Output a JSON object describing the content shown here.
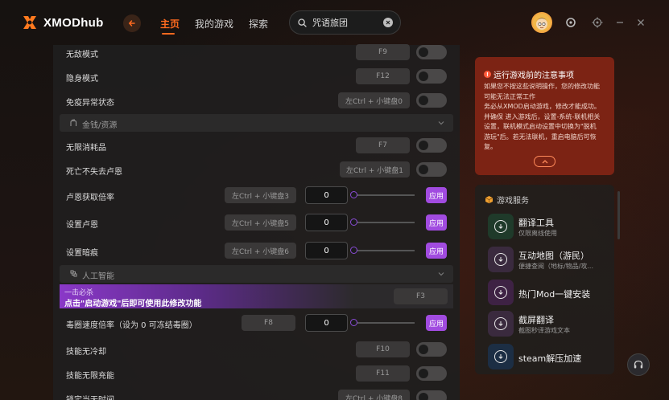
{
  "app": {
    "title": "XMODhub"
  },
  "nav": {
    "home": "主页",
    "my_games": "我的游戏",
    "explore": "探索"
  },
  "search": {
    "value": "咒语旅团"
  },
  "rows": {
    "invincible": {
      "label": "无敌模式",
      "key": "F9"
    },
    "stealth": {
      "label": "隐身模式",
      "key": "F12"
    },
    "immune": {
      "label": "免疫异常状态",
      "key": "左Ctrl + 小键盘0"
    },
    "section_money": "金钱/资源",
    "unlimited_items": {
      "label": "无限消耗品",
      "key": "F7"
    },
    "no_lose_lumen": {
      "label": "死亡不失去卢恩",
      "key": "左Ctrl + 小键盘1"
    },
    "lumen_multiplier": {
      "label": "卢恩获取倍率",
      "key": "左Ctrl + 小键盘3",
      "value": "0",
      "apply": "应用"
    },
    "set_lumen": {
      "label": "设置卢恩",
      "key": "左Ctrl + 小键盘5",
      "value": "0",
      "apply": "应用"
    },
    "set_dark": {
      "label": "设置暗痕",
      "key": "左Ctrl + 小键盘6",
      "value": "0",
      "apply": "应用"
    },
    "section_ai": "人工智能",
    "one_hit": {
      "sub": "一击必杀",
      "main": "点击\"启动游戏\"后即可使用此修改功能",
      "key": "F3"
    },
    "poison_rate": {
      "label": "毒圈速度倍率（设为 0 可冻结毒圈）",
      "key": "F8",
      "value": "0",
      "apply": "应用"
    },
    "no_cooldown": {
      "label": "技能无冷却",
      "key": "F10"
    },
    "unlimited_charge": {
      "label": "技能无限充能",
      "key": "F11"
    },
    "lock_time": {
      "label": "锁定当天时间",
      "key": "左Ctrl + 小键盘8"
    }
  },
  "warning": {
    "title": "运行游戏前的注意事项",
    "lines": [
      "如果您不按这些说明操作，您的修改功能",
      "可能无法正常工作",
      "务必从XMOD启动游戏，修改才能成功。",
      "并确保 进入游戏后，设置-系统-联机相关",
      "设置，联机模式启动设置中切换为\"脱机",
      "游玩\"后。若无法联机，重启电脑后可恢",
      "复。"
    ]
  },
  "services": {
    "title": "游戏服务",
    "items": [
      {
        "name": "翻译工具",
        "desc": "仅限离线使用"
      },
      {
        "name": "互动地图（游民）",
        "desc": "便捷查阅（地标/物品/攻..."
      },
      {
        "name": "热门Mod一键安装",
        "desc": ""
      },
      {
        "name": "截屏翻译",
        "desc": "截图秒译游戏文本"
      },
      {
        "name": "steam解压加速",
        "desc": ""
      }
    ]
  },
  "colors": {
    "accent": "#ff6a1f",
    "apply": "#a14be0",
    "warning_bg": "#7c2314"
  }
}
